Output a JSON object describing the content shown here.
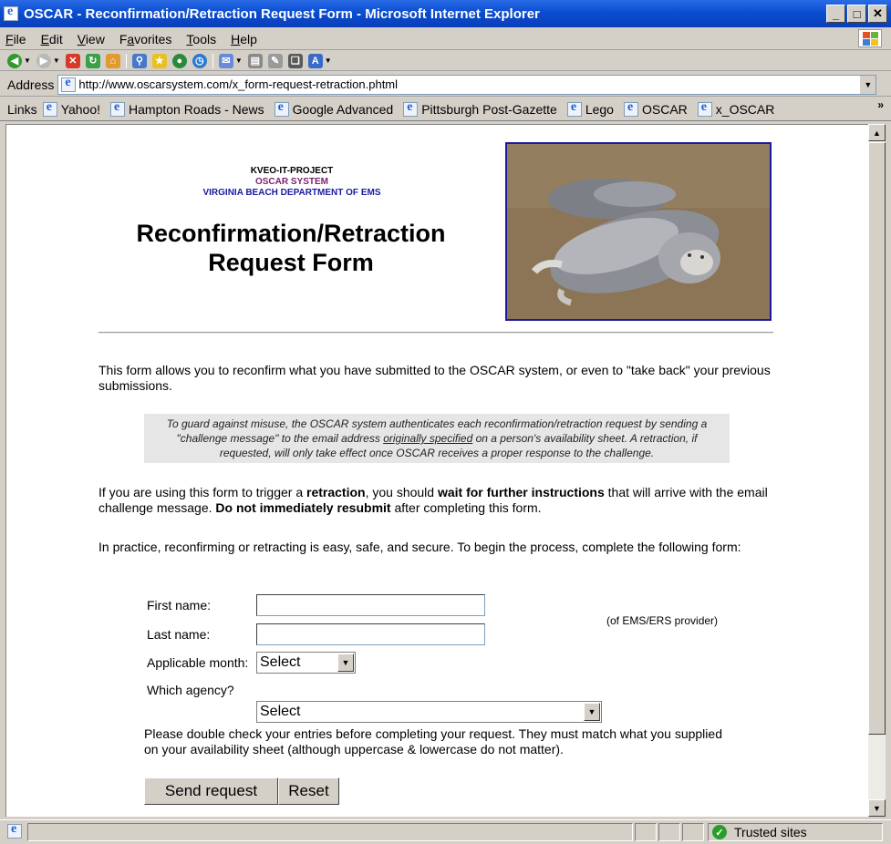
{
  "window": {
    "title": "OSCAR - Reconfirmation/Retraction Request Form - Microsoft Internet Explorer",
    "buttons": [
      "_",
      "□",
      "✕"
    ]
  },
  "menu": [
    {
      "pre": "",
      "u": "F",
      "post": "ile"
    },
    {
      "pre": "",
      "u": "E",
      "post": "dit"
    },
    {
      "pre": "",
      "u": "V",
      "post": "iew"
    },
    {
      "pre": "F",
      "u": "a",
      "post": "vorites"
    },
    {
      "pre": "",
      "u": "T",
      "post": "ools"
    },
    {
      "pre": "",
      "u": "H",
      "post": "elp"
    }
  ],
  "address": {
    "label": "Address",
    "url": "http://www.oscarsystem.com/x_form-request-retraction.phtml"
  },
  "links": {
    "label": "Links",
    "items": [
      "Yahoo!",
      "Hampton Roads - News",
      "Google Advanced",
      "Pittsburgh Post-Gazette",
      "Lego",
      "OSCAR",
      "x_OSCAR"
    ],
    "more": "»"
  },
  "page": {
    "org_line1": "KVEO-IT-PROJECT",
    "org_line2": "OSCAR SYSTEM",
    "org_line3": "VIRGINIA BEACH DEPARTMENT OF EMS",
    "title_line1": "Reconfirmation/Retraction",
    "title_line2": "Request Form",
    "intro": "This form allows you to reconfirm what you have submitted to the OSCAR system, or even to \"take back\" your previous submissions.",
    "note_a": "To guard against misuse, the OSCAR system authenticates each reconfirmation/retraction request by sending a \"challenge message\" to the email address ",
    "note_u": "originally specified",
    "note_b": " on a person's availability sheet.  A retraction, if requested, will only take effect once OSCAR receives a proper response to the challenge.",
    "retr_1": "If you are using this form to trigger a ",
    "retr_2": "retraction",
    "retr_3": ", you should ",
    "retr_4": "wait for further instructions",
    "retr_5": " that will arrive with the email challenge message.  ",
    "retr_6": "Do not immediately resubmit",
    "retr_7": " after completing this form.",
    "practice": "In practice, reconfirming or retracting is easy, safe, and secure. To begin the process, complete the following form:",
    "form": {
      "first_name_label": "First name:",
      "last_name_label": "Last name:",
      "month_label": "Applicable month:",
      "agency_label": "Which agency?",
      "hint": "(of EMS/ERS provider)",
      "first_name_value": "",
      "last_name_value": "",
      "month_value": "Select",
      "agency_value": "Select"
    },
    "check_note": "Please double check your entries before completing your request.  They must match what you supplied on your availability sheet (although uppercase & lowercase do not matter).",
    "send_label": "Send request",
    "reset_label": "Reset"
  },
  "status": {
    "zone": "Trusted sites"
  },
  "colors": {
    "title_blue": "#0a4dd0",
    "org_purple": "#7a1f6e",
    "org_blue": "#1a1aa0"
  }
}
